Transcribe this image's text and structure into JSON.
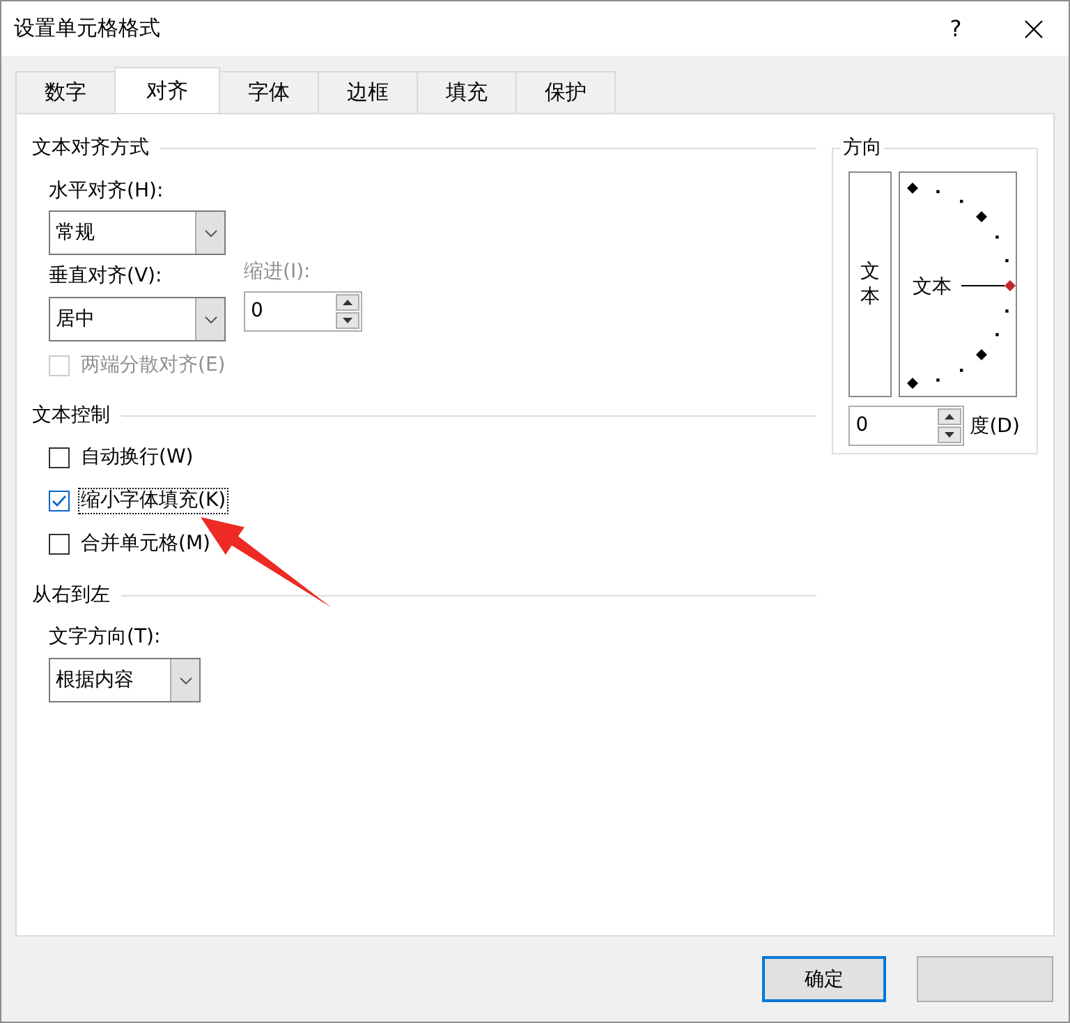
{
  "window": {
    "title": "设置单元格格式",
    "help": "?"
  },
  "tabs": [
    {
      "label": "数字",
      "selected": false
    },
    {
      "label": "对齐",
      "selected": true
    },
    {
      "label": "字体",
      "selected": false
    },
    {
      "label": "边框",
      "selected": false
    },
    {
      "label": "填充",
      "selected": false
    },
    {
      "label": "保护",
      "selected": false
    }
  ],
  "alignment": {
    "heading": "文本对齐方式",
    "horizontal": {
      "label": "水平对齐(H):",
      "value": "常规"
    },
    "vertical": {
      "label": "垂直对齐(V):",
      "value": "居中"
    },
    "indent": {
      "label": "缩进(I):",
      "value": "0",
      "disabled": true
    },
    "justify_distributed": {
      "label": "两端分散对齐(E)",
      "checked": false,
      "disabled": true
    }
  },
  "text_control": {
    "heading": "文本控制",
    "options": [
      {
        "label": "自动换行(W)",
        "checked": false,
        "focused": false
      },
      {
        "label": "缩小字体填充(K)",
        "checked": true,
        "focused": true
      },
      {
        "label": "合并单元格(M)",
        "checked": false,
        "focused": false
      }
    ]
  },
  "right_to_left": {
    "heading": "从右到左",
    "direction": {
      "label": "文字方向(T):",
      "value": "根据内容"
    }
  },
  "orientation": {
    "heading": "方向",
    "vertical_text": "文本",
    "dial_text": "文本",
    "degrees": {
      "value": "0",
      "unit": "度(D)"
    }
  },
  "buttons": [
    {
      "label": "确定",
      "default": true
    },
    {
      "default": false
    }
  ]
}
